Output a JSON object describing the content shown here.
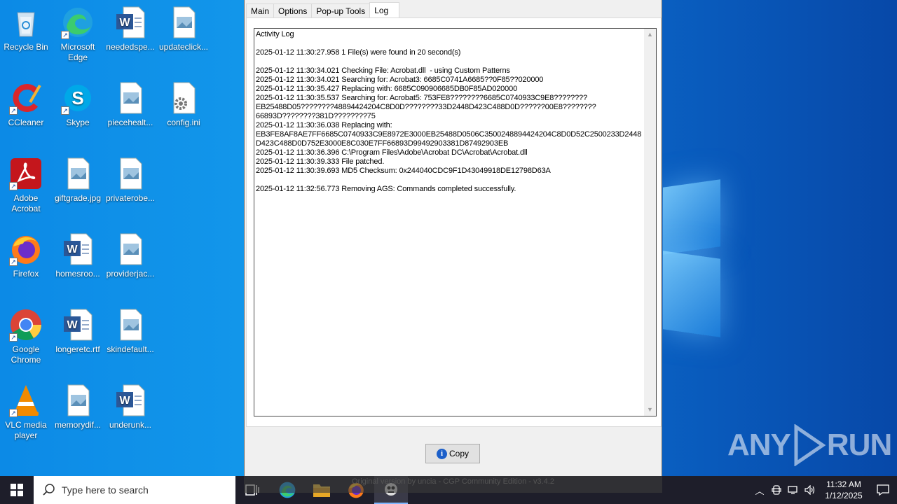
{
  "desktop": {
    "icons": [
      {
        "label": "Recycle Bin",
        "icon": "recycle-bin-icon"
      },
      {
        "label": "Microsoft Edge",
        "icon": "edge-icon"
      },
      {
        "label": "neededspe...",
        "icon": "word-doc-icon"
      },
      {
        "label": "updateclick...",
        "icon": "image-file-icon"
      },
      {
        "label": "CCleaner",
        "icon": "ccleaner-icon"
      },
      {
        "label": "Skype",
        "icon": "skype-icon"
      },
      {
        "label": "piecehealt...",
        "icon": "image-file-icon"
      },
      {
        "label": "config.ini",
        "icon": "ini-file-icon"
      },
      {
        "label": "Adobe Acrobat",
        "icon": "acrobat-icon"
      },
      {
        "label": "giftgrade.jpg",
        "icon": "image-file-icon"
      },
      {
        "label": "privaterobe...",
        "icon": "image-file-icon"
      },
      {
        "label": "Firefox",
        "icon": "firefox-icon"
      },
      {
        "label": "homesroo...",
        "icon": "word-doc-icon"
      },
      {
        "label": "providerjac...",
        "icon": "image-file-icon"
      },
      {
        "label": "Google Chrome",
        "icon": "chrome-icon"
      },
      {
        "label": "longeretc.rtf",
        "icon": "word-doc-icon"
      },
      {
        "label": "skindefault...",
        "icon": "image-file-icon"
      },
      {
        "label": "VLC media player",
        "icon": "vlc-icon"
      },
      {
        "label": "memorydif...",
        "icon": "image-file-icon"
      },
      {
        "label": "underunk...",
        "icon": "word-doc-icon"
      }
    ]
  },
  "app": {
    "tabs": [
      "Main",
      "Options",
      "Pop-up Tools",
      "Log"
    ],
    "active_tab": "Log",
    "log_text": "Activity Log\n\n2025-01-12 11:30:27.958 1 File(s) were found in 20 second(s)\n\n2025-01-12 11:30:34.021 Checking File: Acrobat.dll  - using Custom Patterns\n2025-01-12 11:30:34.021 Searching for: Acrobat3: 6685C0741A6685??0F85??020000\n2025-01-12 11:30:35.427 Replacing with: 6685C090906685DB0F85AD020000\n2025-01-12 11:30:35.537 Searching for: Acrobat5: 753FE8????????6685C0740933C9E8????????\nEB25488D05????????48894424204C8D0D????????33D2448D423C488D0D??????00E8????????\n66893D????????381D????????75\n2025-01-12 11:30:36.038 Replacing with:\nEB3FE8AF8AE7FF6685C0740933C9E8972E3000EB25488D0506C3500248894424204C8D0D52C2500233D2448\nD423C488D0D752E3000E8C030E7FF66893D99492903381D87492903EB\n2025-01-12 11:30:36.396 C:\\Program Files\\Adobe\\Acrobat DC\\Acrobat\\Acrobat.dll\n2025-01-12 11:30:39.333 File patched.\n2025-01-12 11:30:39.693 MD5 Checksum: 0x244040CDC9F1D43049918DE12798D63A\n\n2025-01-12 11:32:56.773 Removing AGS: Commands completed successfully.",
    "copy_label": "Copy",
    "footer_text": "Original version by uncia - CGP Community Edition - v3.4.2"
  },
  "watermark": {
    "text_left": "ANY",
    "text_right": "RUN"
  },
  "taskbar": {
    "search_placeholder": "Type here to search",
    "apps": [
      "task-view-icon",
      "edge-icon",
      "file-explorer-icon",
      "firefox-icon",
      "patcher-app-icon"
    ],
    "clock_time": "11:32 AM",
    "clock_date": "1/12/2025"
  },
  "colors": {
    "accent": "#1296ea",
    "taskbar": "#1e1e2a",
    "window_bg": "#f0f0f0"
  }
}
